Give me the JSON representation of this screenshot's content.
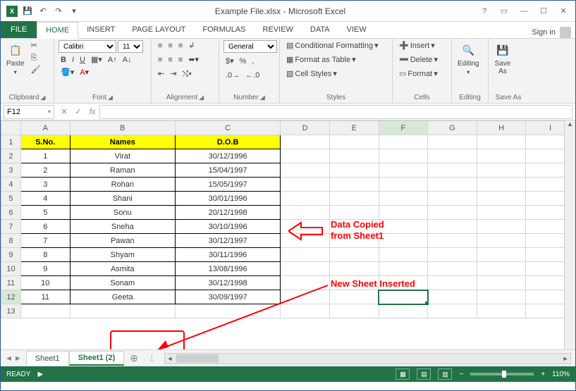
{
  "title": "Example File.xlsx - Microsoft Excel",
  "signin": "Sign in",
  "tabs": {
    "file": "FILE",
    "home": "HOME",
    "insert": "INSERT",
    "pagelayout": "PAGE LAYOUT",
    "formulas": "FORMULAS",
    "review": "REVIEW",
    "data": "DATA",
    "view": "VIEW"
  },
  "ribbon": {
    "clipboard": {
      "label": "Clipboard",
      "paste": "Paste"
    },
    "font": {
      "label": "Font",
      "name": "Calibri",
      "size": "11",
      "bold": "B",
      "italic": "I",
      "underline": "U"
    },
    "alignment": {
      "label": "Alignment"
    },
    "number": {
      "label": "Number",
      "format": "General"
    },
    "styles": {
      "label": "Styles",
      "cf": "Conditional Formatting",
      "fat": "Format as Table",
      "cs": "Cell Styles"
    },
    "cells": {
      "label": "Cells",
      "insert": "Insert",
      "delete": "Delete",
      "format": "Format"
    },
    "editing": {
      "label": "Editing",
      "editing": "Editing"
    },
    "saveas": {
      "label": "Save As",
      "btn": "Save\nAs"
    }
  },
  "namebox": "F12",
  "columns": [
    "A",
    "B",
    "C",
    "D",
    "E",
    "F",
    "G",
    "H",
    "I"
  ],
  "row_count": 13,
  "headers": {
    "sno": "S.No.",
    "names": "Names",
    "dob": "D.O.B"
  },
  "rows": [
    {
      "sno": "1",
      "name": "Virat",
      "dob": "30/12/1996"
    },
    {
      "sno": "2",
      "name": "Raman",
      "dob": "15/04/1997"
    },
    {
      "sno": "3",
      "name": "Rohan",
      "dob": "15/05/1997"
    },
    {
      "sno": "4",
      "name": "Shani",
      "dob": "30/01/1996"
    },
    {
      "sno": "5",
      "name": "Sonu",
      "dob": "20/12/1998"
    },
    {
      "sno": "6",
      "name": "Sneha",
      "dob": "30/10/1996"
    },
    {
      "sno": "7",
      "name": "Pawan",
      "dob": "30/12/1997"
    },
    {
      "sno": "8",
      "name": "Shyam",
      "dob": "30/11/1996"
    },
    {
      "sno": "9",
      "name": "Asmita",
      "dob": "13/08/1996"
    },
    {
      "sno": "10",
      "name": "Sonam",
      "dob": "30/12/1998"
    },
    {
      "sno": "11",
      "name": "Geeta",
      "dob": "30/09/1997"
    }
  ],
  "sheet_tabs": {
    "s1": "Sheet1",
    "s2": "Sheet1 (2)"
  },
  "annotations": {
    "copied": "Data Copied\nfrom Sheet1",
    "newsheet": "New Sheet Inserted"
  },
  "status": {
    "ready": "READY",
    "zoom": "110%"
  }
}
